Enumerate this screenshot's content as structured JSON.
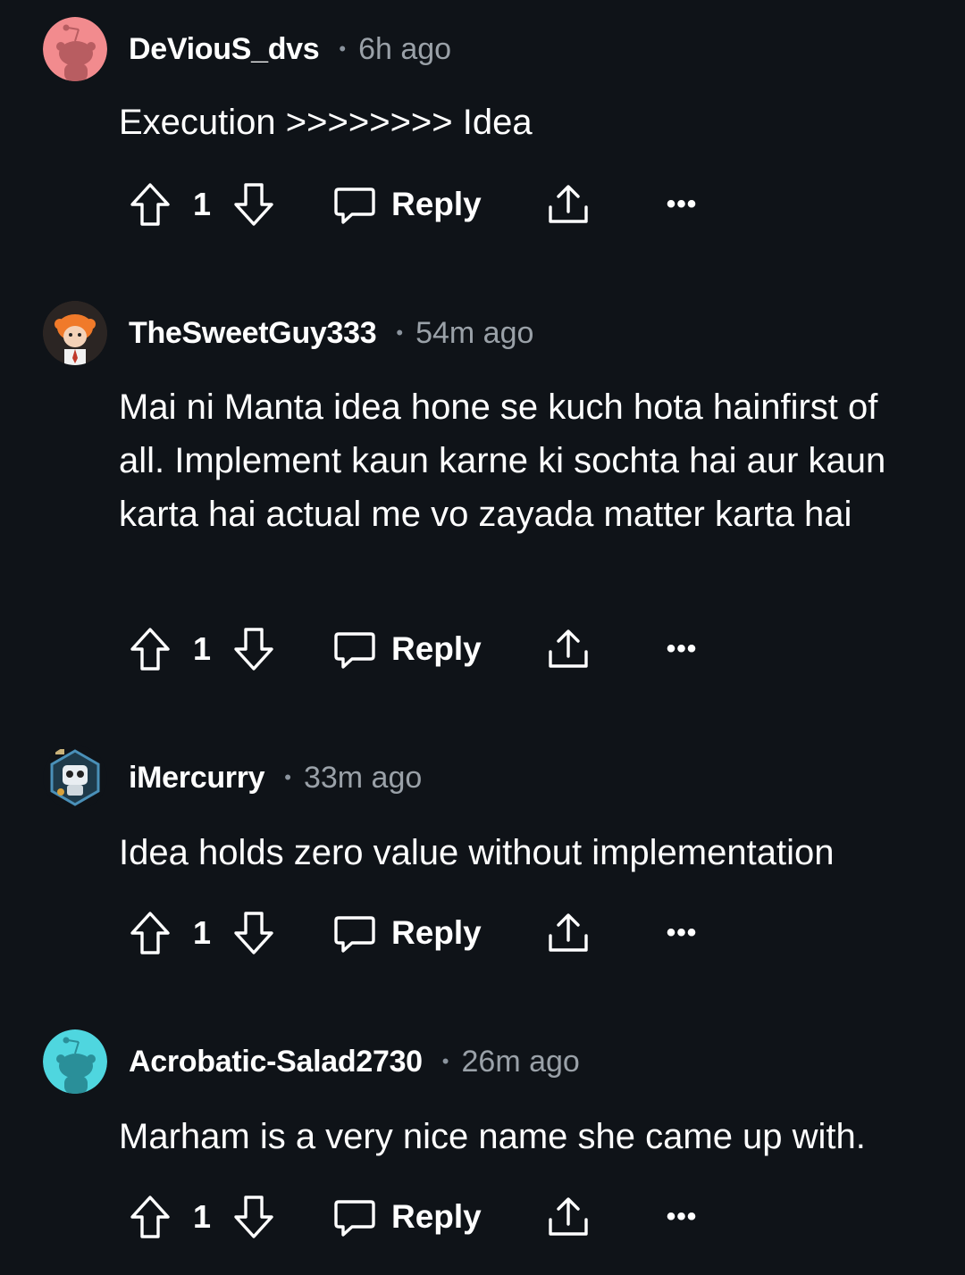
{
  "comments": [
    {
      "username": "DeViouS_dvs",
      "separator": "•",
      "time": "6h ago",
      "text": "Execution >>>>>>>> Idea",
      "score": "1",
      "reply_label": "Reply",
      "avatar": {
        "icon": "snoo-avatar",
        "color": "#f28b8e"
      }
    },
    {
      "username": "TheSweetGuy333",
      "separator": "•",
      "time": "54m ago",
      "text": "Mai ni Manta idea hone se kuch hota hainfirst of all. Implement kaun karne ki sochta hai aur kaun karta hai actual me vo zayada matter karta hai",
      "score": "1",
      "reply_label": "Reply",
      "avatar": {
        "icon": "custom-avatar",
        "color": "#3a2a22"
      }
    },
    {
      "username": "iMercurry",
      "separator": "•",
      "time": "33m ago",
      "text": "Idea holds zero value without implementation",
      "score": "1",
      "reply_label": "Reply",
      "avatar": {
        "icon": "robot-avatar",
        "color": "#1e3a4a"
      }
    },
    {
      "username": "Acrobatic-Salad2730",
      "separator": "•",
      "time": "26m ago",
      "text": "Marham is a very nice name she came up with.",
      "score": "1",
      "reply_label": "Reply",
      "avatar": {
        "icon": "snoo-avatar",
        "color": "#4fd6df"
      }
    }
  ],
  "more_label": "•••",
  "icons": {
    "upvote": "upvote-arrow-icon",
    "downvote": "downvote-arrow-icon",
    "reply": "comment-bubble-icon",
    "share": "share-icon",
    "more": "more-options-icon"
  },
  "colors": {
    "background": "#0f1318",
    "text": "#ffffff",
    "meta": "#9aa1a8"
  }
}
